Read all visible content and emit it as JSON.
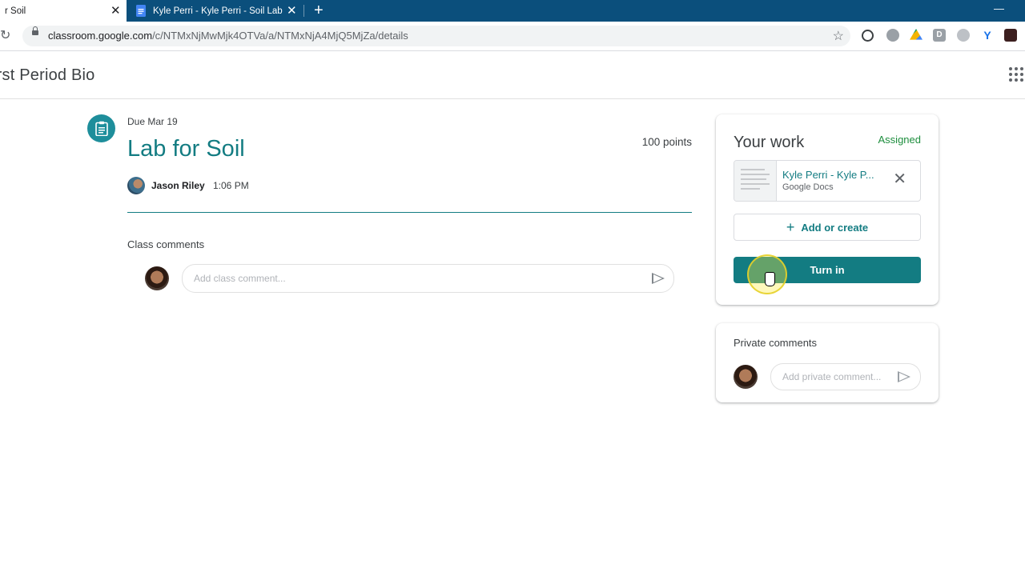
{
  "browser": {
    "tabs": [
      {
        "title": "r Soil",
        "active": true
      },
      {
        "title": "Kyle Perri - Kyle Perri - Soil Lab R",
        "active": false
      }
    ],
    "new_tab_symbol": "+",
    "close_symbol": "✕",
    "minimize_symbol": "—",
    "url_host": "classroom.google.com",
    "url_path": "/c/NTMxNjMwMjk4OTVa/a/NTMxNjA4MjQ5MjZa/details",
    "star_symbol": "☆",
    "reload_symbol": "↻"
  },
  "header": {
    "class_title": "irst Period Bio"
  },
  "assignment": {
    "due": "Due Mar 19",
    "title": "Lab for Soil",
    "points": "100 points",
    "author": "Jason Riley",
    "time": "1:06 PM",
    "class_comments_label": "Class comments",
    "comment_placeholder": "Add class comment..."
  },
  "your_work": {
    "title": "Your work",
    "status": "Assigned",
    "attachment_title": "Kyle Perri - Kyle P...",
    "attachment_type": "Google Docs",
    "add_label": "Add or create",
    "turn_in_label": "Turn in",
    "remove_symbol": "✕",
    "plus_symbol": "+"
  },
  "private_comments": {
    "title": "Private comments",
    "placeholder": "Add private comment..."
  },
  "colors": {
    "accent": "#137c82",
    "tab_strip": "#0b4f7c",
    "assigned": "#1e8e3e"
  }
}
